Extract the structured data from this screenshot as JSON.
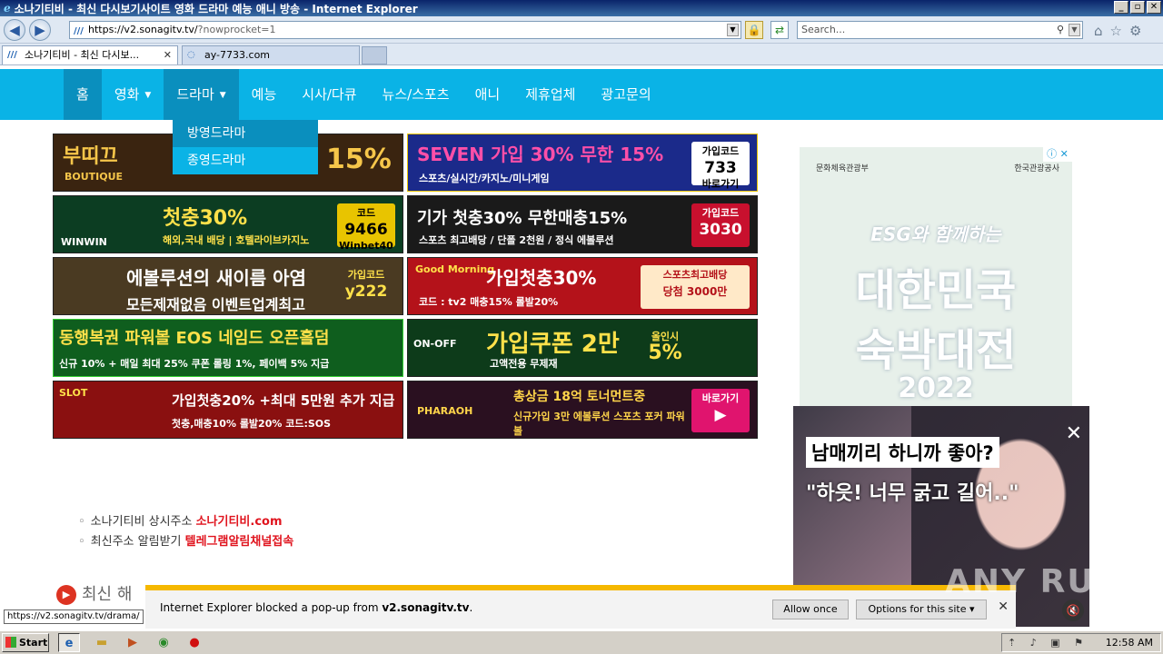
{
  "window": {
    "title": "소나기티비 - 최신 다시보기사이트 영화 드라마 예능 애니 방송 - Internet Explorer"
  },
  "addressbar": {
    "url_host": "https://v2.sonagitv.tv/",
    "url_rest": "?nowprocket=1",
    "search_placeholder": "Search..."
  },
  "tabs": [
    {
      "label": "소나기티비 - 최신 다시보...",
      "active": true
    },
    {
      "label": "ay-7733.com",
      "active": false
    }
  ],
  "site_nav": {
    "items": [
      {
        "label": "홈"
      },
      {
        "label": "영화",
        "has_caret": true
      },
      {
        "label": "드라마",
        "has_caret": true
      },
      {
        "label": "예능"
      },
      {
        "label": "시사/다큐"
      },
      {
        "label": "뉴스/스포츠"
      },
      {
        "label": "애니"
      },
      {
        "label": "제휴업체"
      },
      {
        "label": "광고문의"
      }
    ],
    "dropdown": [
      {
        "label": "방영드라마"
      },
      {
        "label": "종영드라마"
      }
    ]
  },
  "banners": [
    {
      "main": "부띠끄",
      "sub": "BOUTIQUE",
      "accent": "15%",
      "bg": "#3a2410",
      "fg": "#f6c64a"
    },
    {
      "main": "SEVEN 가입 30% 무한 15%",
      "sub": "스포츠/실시간/카지노/미니게임",
      "badge_line1": "가입코드",
      "badge_line2": "733",
      "badge_line3": "바로가기",
      "bg": "#1b2a8a",
      "fg": "#ffffff"
    },
    {
      "main": "첫충30%",
      "sub": "해외,국내 배당 | 호텔라이브카지노",
      "brand": "WINWIN",
      "badge_line1": "코드",
      "badge_line2": "9466",
      "badge_line3": "Winbet40",
      "bg": "#0c3d22",
      "fg": "#ffe14a"
    },
    {
      "main": "기가 첫충30% 무한매충15%",
      "sub": "스포츠 최고배당 / 단폴 2천원 / 정식 에볼루션",
      "badge_line1": "가입코드",
      "badge_line2": "3030",
      "bg": "#1a1a1a",
      "fg": "#ffffff"
    },
    {
      "main": "에볼루션의 새이름 아염",
      "sub": "모든제재없음 이벤트업계최고",
      "badge_line1": "가입코드",
      "badge_line2": "y222",
      "bg": "#4a3a22",
      "fg": "#ffffff"
    },
    {
      "main": "가입첫충30%",
      "sub": "코드 : tv2 매충15% 롤발20%",
      "brand": "Good Morning",
      "badge_line1": "스포츠최고배당",
      "badge_line2": "당첨 3000만",
      "bg": "#b4121a",
      "fg": "#ffffff"
    },
    {
      "main": "동행복권 파워볼 EOS 네임드 오픈홀덤",
      "sub": "신규 10% + 매일 최대 25% 쿠폰  롤링 1%, 페이백 5% 지급",
      "bg": "#0f5e1e",
      "fg": "#ffe14a"
    },
    {
      "main": "가입쿠폰 2만",
      "sub": "고액전용 무제재",
      "brand": "ON-OFF",
      "badge_line1": "올인시",
      "badge_line2": "5%",
      "bg": "#0d3b1a",
      "fg": "#ffe14a"
    },
    {
      "main": "가입첫충20% +최대 5만원 추가 지급",
      "sub": "첫충,매충10% 롤발20%  코드:SOS",
      "brand": "SLOT",
      "bg": "#8a1010",
      "fg": "#ffffff"
    },
    {
      "main": "총상금 18억 토너먼트중",
      "sub": "신규가입 3만 에볼루션 스포츠 포커 파워볼",
      "brand": "PHARAOH",
      "badge_line1": "바로가기",
      "bg": "#2a1020",
      "fg": "#ffd54a"
    }
  ],
  "right_ad": {
    "org_left": "문화체육관광부",
    "org_right": "한국관광공사",
    "line1": "ESG와 함께하는",
    "line2": "대한민국",
    "line3": "숙박대전",
    "line4": "2022"
  },
  "overlay_ad": {
    "line1": "남매끼리 하니까 좋아?",
    "line2": "\"하읏! 너무 굵고 길어..\""
  },
  "info": [
    {
      "text": "소나기티비 상시주소",
      "link": "소나기티비.com"
    },
    {
      "text": "최신주소 알림받기",
      "link": "텔레그램알림채널접속"
    }
  ],
  "section_title": "최신 해",
  "popup_bar": {
    "msg_prefix": "Internet Explorer blocked a pop-up from ",
    "msg_domain": "v2.sonagitv.tv",
    "msg_suffix": ".",
    "allow_label": "Allow once",
    "options_label": "Options for this site ▾"
  },
  "status_url": "https://v2.sonagitv.tv/drama/",
  "watermark": "ANY RUN",
  "taskbar": {
    "start_label": "Start",
    "clock": "12:58 AM"
  },
  "colors": {
    "nav_bg": "#0ab3e6",
    "nav_active": "#0a8fbe",
    "link_red": "#e0141e",
    "popup_border": "#f5b800"
  }
}
